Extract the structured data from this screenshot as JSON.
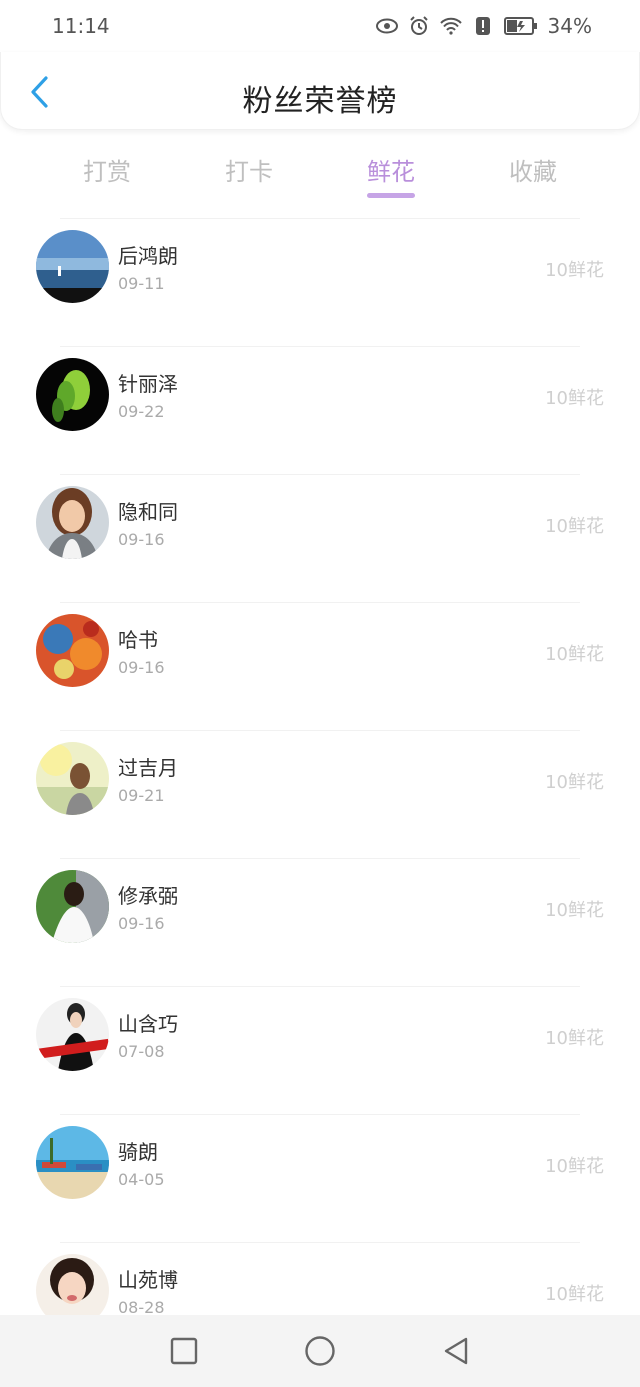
{
  "status": {
    "time": "11:14",
    "battery": "34%",
    "icons": [
      "eye-icon",
      "alarm-icon",
      "wifi-icon",
      "alert-icon",
      "battery-icon"
    ]
  },
  "header": {
    "title": "粉丝荣誉榜",
    "back_icon": "chevron-left-icon"
  },
  "tabs": [
    {
      "label": "打赏",
      "active": false
    },
    {
      "label": "打卡",
      "active": false
    },
    {
      "label": "鲜花",
      "active": true
    },
    {
      "label": "收藏",
      "active": false
    }
  ],
  "fans": [
    {
      "name": "后鸿朗",
      "date": "09-11",
      "count": "10鲜花",
      "avatar": "sea-scene-avatar"
    },
    {
      "name": "针丽泽",
      "date": "09-22",
      "count": "10鲜花",
      "avatar": "green-tulip-avatar"
    },
    {
      "name": "隐和同",
      "date": "09-16",
      "count": "10鲜花",
      "avatar": "smiling-woman-avatar"
    },
    {
      "name": "哈书",
      "date": "09-16",
      "count": "10鲜花",
      "avatar": "painting-avatar"
    },
    {
      "name": "过吉月",
      "date": "09-21",
      "count": "10鲜花",
      "avatar": "sunlit-girl-avatar"
    },
    {
      "name": "修承弼",
      "date": "09-16",
      "count": "10鲜花",
      "avatar": "bride-avatar"
    },
    {
      "name": "山含巧",
      "date": "07-08",
      "count": "10鲜花",
      "avatar": "woman-black-avatar"
    },
    {
      "name": "骑朗",
      "date": "04-05",
      "count": "10鲜花",
      "avatar": "beach-avatar"
    },
    {
      "name": "山苑博",
      "date": "08-28",
      "count": "10鲜花",
      "avatar": "girl-face-avatar"
    }
  ],
  "navbar": {
    "icons": [
      "square-recents-icon",
      "circle-home-icon",
      "triangle-back-icon"
    ]
  },
  "colors": {
    "accent": "#b98fdb",
    "tab_inactive": "#bfbfbf",
    "count_text": "#cfcfcf",
    "back_arrow": "#2ea0e6"
  }
}
